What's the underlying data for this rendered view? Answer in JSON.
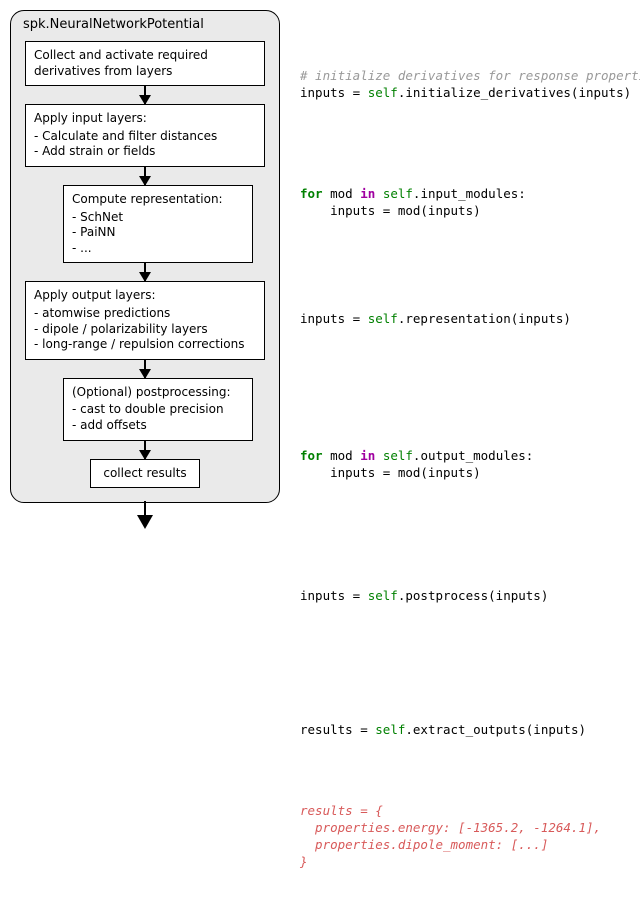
{
  "module": {
    "title": "spk.NeuralNetworkPotential"
  },
  "steps": {
    "collect": {
      "title": "Collect and activate required derivatives from layers"
    },
    "input_layers": {
      "title": "Apply input layers:",
      "items": [
        "Calculate and filter distances",
        "Add strain or fields"
      ]
    },
    "representation": {
      "title": "Compute representation:",
      "items": [
        "SchNet",
        "PaiNN",
        "..."
      ]
    },
    "output_layers": {
      "title": "Apply output layers:",
      "items": [
        "atomwise predictions",
        "dipole / polarizability layers",
        "long-range / repulsion corrections"
      ]
    },
    "postprocess": {
      "title": "(Optional) postprocessing:",
      "items": [
        "cast to double precision",
        "add offsets"
      ]
    },
    "collect_results": {
      "title": "collect results"
    }
  },
  "code": {
    "c1_comment": "# initialize derivatives for response properties",
    "c1_line": "inputs = self.initialize_derivatives(inputs)",
    "c2_l1_a": "for",
    "c2_l1_b": " mod ",
    "c2_l1_c": "in",
    "c2_l1_d": " self.input_modules:",
    "c2_l2": "    inputs = mod(inputs)",
    "c3_line": "inputs = self.representation(inputs)",
    "c4_l1_a": "for",
    "c4_l1_b": " mod ",
    "c4_l1_c": "in",
    "c4_l1_d": " self.output_modules:",
    "c4_l2": "    inputs = mod(inputs)",
    "c5_line": "inputs = self.postprocess(inputs)",
    "c6_line": "results = self.extract_outputs(inputs)",
    "res_l1": "results = {",
    "res_l2": "  properties.energy: [-1365.2, -1264.1],",
    "res_l3": "  properties.dipole_moment: [...]",
    "res_l4": "}"
  }
}
